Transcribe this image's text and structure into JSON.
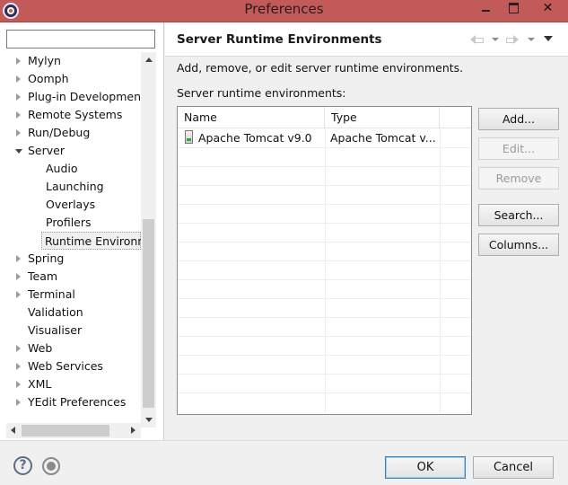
{
  "window": {
    "title": "Preferences",
    "close_glyph": "✕",
    "title_bar_color": "#c35a5a"
  },
  "filter": {
    "value": "",
    "placeholder": ""
  },
  "tree": {
    "items": [
      {
        "label": "Mylyn",
        "expandable": true,
        "expanded": false,
        "level": 0
      },
      {
        "label": "Oomph",
        "expandable": true,
        "expanded": false,
        "level": 0
      },
      {
        "label": "Plug-in Development",
        "expandable": true,
        "expanded": false,
        "level": 0
      },
      {
        "label": "Remote Systems",
        "expandable": true,
        "expanded": false,
        "level": 0
      },
      {
        "label": "Run/Debug",
        "expandable": true,
        "expanded": false,
        "level": 0
      },
      {
        "label": "Server",
        "expandable": true,
        "expanded": true,
        "level": 0
      },
      {
        "label": "Audio",
        "expandable": false,
        "expanded": false,
        "level": 1
      },
      {
        "label": "Launching",
        "expandable": false,
        "expanded": false,
        "level": 1
      },
      {
        "label": "Overlays",
        "expandable": false,
        "expanded": false,
        "level": 1
      },
      {
        "label": "Profilers",
        "expandable": false,
        "expanded": false,
        "level": 1
      },
      {
        "label": "Runtime Environm",
        "expandable": false,
        "expanded": false,
        "level": 1,
        "selected": true
      },
      {
        "label": "Spring",
        "expandable": true,
        "expanded": false,
        "level": 0
      },
      {
        "label": "Team",
        "expandable": true,
        "expanded": false,
        "level": 0
      },
      {
        "label": "Terminal",
        "expandable": true,
        "expanded": false,
        "level": 0
      },
      {
        "label": "Validation",
        "expandable": false,
        "expanded": false,
        "level": 0
      },
      {
        "label": "Visualiser",
        "expandable": false,
        "expanded": false,
        "level": 0
      },
      {
        "label": "Web",
        "expandable": true,
        "expanded": false,
        "level": 0
      },
      {
        "label": "Web Services",
        "expandable": true,
        "expanded": false,
        "level": 0
      },
      {
        "label": "XML",
        "expandable": true,
        "expanded": false,
        "level": 0
      },
      {
        "label": "YEdit Preferences",
        "expandable": true,
        "expanded": false,
        "level": 0
      }
    ]
  },
  "page": {
    "title": "Server Runtime Environments",
    "description": "Add, remove, or edit server runtime environments.",
    "list_label": "Server runtime environments:",
    "table": {
      "columns": [
        "Name",
        "Type"
      ],
      "rows": [
        {
          "name": "Apache Tomcat v9.0",
          "type": "Apache Tomcat v..."
        }
      ]
    },
    "buttons": {
      "add": "Add...",
      "edit": "Edit...",
      "remove": "Remove",
      "search": "Search...",
      "columns": "Columns..."
    }
  },
  "dialog": {
    "ok": "OK",
    "cancel": "Cancel",
    "help_glyph": "?"
  }
}
